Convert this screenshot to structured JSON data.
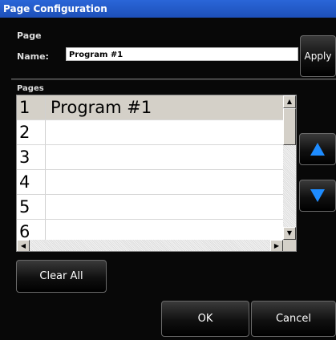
{
  "window": {
    "title": "Page Configuration"
  },
  "page_section": {
    "label": "Page",
    "name_label": "Name:",
    "name_value": "Program #1",
    "apply_label": "Apply"
  },
  "pages_section": {
    "label": "Pages",
    "rows": [
      {
        "number": "1",
        "title": "Program #1",
        "selected": true
      },
      {
        "number": "2",
        "title": "",
        "selected": false
      },
      {
        "number": "3",
        "title": "",
        "selected": false
      },
      {
        "number": "4",
        "title": "",
        "selected": false
      },
      {
        "number": "5",
        "title": "",
        "selected": false
      },
      {
        "number": "6",
        "title": "",
        "selected": false
      }
    ]
  },
  "buttons": {
    "clear_all": "Clear All",
    "ok": "OK",
    "cancel": "Cancel"
  },
  "icons": {
    "move_up": "arrow-up-icon",
    "move_down": "arrow-down-icon"
  },
  "colors": {
    "title_bar": "#1d4fb8",
    "accent_arrow": "#1e8cff",
    "selected_row": "#d4d0c8"
  }
}
